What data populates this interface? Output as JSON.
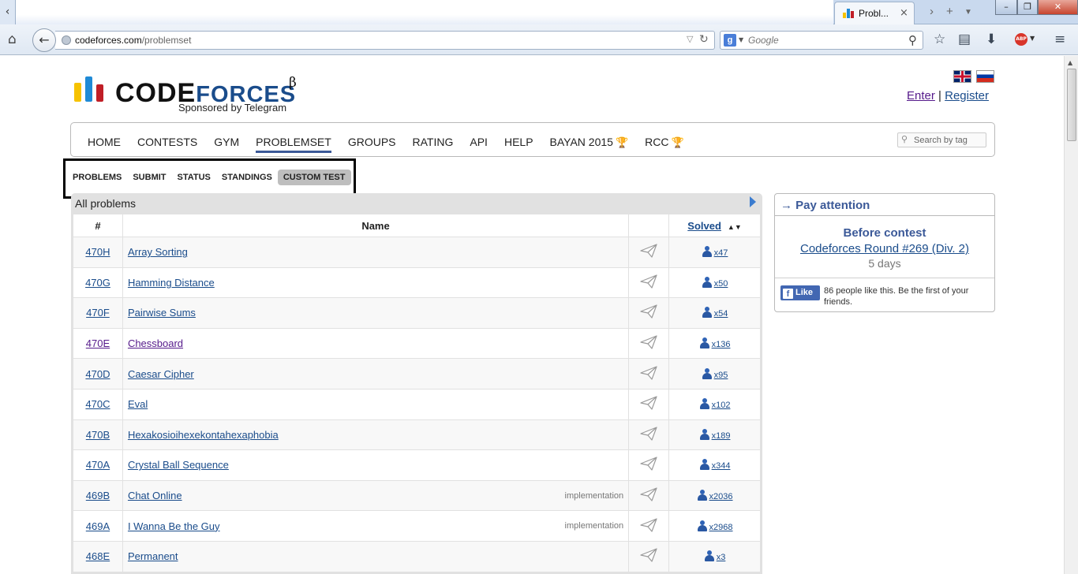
{
  "browser": {
    "tab_title": "Probl...",
    "tab_close": "×",
    "url_host": "codeforces.com",
    "url_path": "/problemset",
    "search_placeholder": "Google",
    "search_engine_letter": "g",
    "abp_label": "ABP"
  },
  "header": {
    "logo_main": "CODE",
    "logo_forces": "FORCES",
    "logo_beta": "β",
    "sponsor": "Sponsored by Telegram",
    "enter": "Enter",
    "separator": "|",
    "register": "Register"
  },
  "menu": {
    "items": [
      "HOME",
      "CONTESTS",
      "GYM",
      "PROBLEMSET",
      "GROUPS",
      "RATING",
      "API",
      "HELP",
      "BAYAN 2015",
      "RCC"
    ],
    "active": "PROBLEMSET",
    "tag_search_placeholder": "Search by tag"
  },
  "submenu": {
    "items": [
      "PROBLEMS",
      "SUBMIT",
      "STATUS",
      "STANDINGS",
      "CUSTOM TEST"
    ],
    "active": "CUSTOM TEST"
  },
  "problems": {
    "title": "All problems",
    "headers": {
      "id": "#",
      "name": "Name",
      "solved": "Solved"
    },
    "rows": [
      {
        "id": "470H",
        "name": "Array Sorting",
        "tag": "",
        "solved": "x47",
        "visited": false
      },
      {
        "id": "470G",
        "name": "Hamming Distance",
        "tag": "",
        "solved": "x50",
        "visited": false
      },
      {
        "id": "470F",
        "name": "Pairwise Sums",
        "tag": "",
        "solved": "x54",
        "visited": false
      },
      {
        "id": "470E",
        "name": "Chessboard",
        "tag": "",
        "solved": "x136",
        "visited": true
      },
      {
        "id": "470D",
        "name": "Caesar Cipher",
        "tag": "",
        "solved": "x95",
        "visited": false
      },
      {
        "id": "470C",
        "name": "Eval",
        "tag": "",
        "solved": "x102",
        "visited": false
      },
      {
        "id": "470B",
        "name": "Hexakosioihexekontahexaphobia",
        "tag": "",
        "solved": "x189",
        "visited": false
      },
      {
        "id": "470A",
        "name": "Crystal Ball Sequence",
        "tag": "",
        "solved": "x344",
        "visited": false
      },
      {
        "id": "469B",
        "name": "Chat Online",
        "tag": "implementation",
        "solved": "x2036",
        "visited": false
      },
      {
        "id": "469A",
        "name": "I Wanna Be the Guy",
        "tag": "implementation",
        "solved": "x2968",
        "visited": false
      },
      {
        "id": "468E",
        "name": "Permanent",
        "tag": "",
        "solved": "x3",
        "visited": false
      }
    ]
  },
  "sidebar": {
    "title": "→ Pay attention",
    "before": "Before contest",
    "round": "Codeforces Round #269 (Div. 2)",
    "days": "5 days",
    "fb_like": "Like",
    "fb_text": "86 people like this. Be the first of your friends."
  },
  "colors": {
    "link": "#1a4c8b",
    "visited": "#551a8b",
    "accent": "#3b5998",
    "logo_yellow": "#f6c200",
    "logo_blue": "#1f8ad6",
    "logo_red": "#c01e26"
  }
}
